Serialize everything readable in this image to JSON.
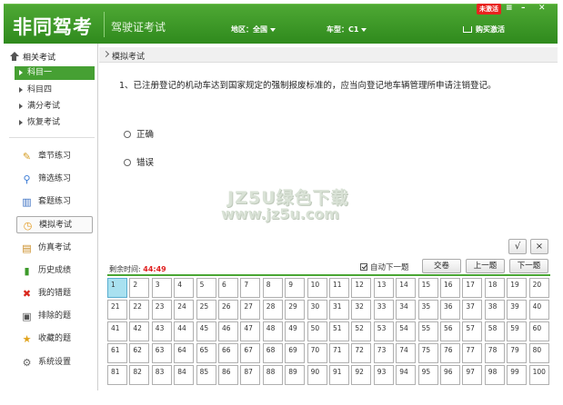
{
  "header": {
    "logo": "非同驾考",
    "subtitle": "驾驶证考试",
    "region": "地区：全国",
    "car_type": "车型：C1",
    "buy": "购买激活",
    "badge": "未激活",
    "menu_btn": "≡",
    "minimize_btn": "–",
    "close_btn": "✕"
  },
  "sidebar": {
    "heading": "相关考试",
    "subitems": [
      "科目一",
      "科目四",
      "满分考试",
      "恢复考试"
    ],
    "menu": [
      {
        "label": "章节练习",
        "icon": "pencil-icon"
      },
      {
        "label": "筛选练习",
        "icon": "search-icon"
      },
      {
        "label": "套题练习",
        "icon": "books-icon"
      },
      {
        "label": "模拟考试",
        "icon": "clock-icon"
      },
      {
        "label": "仿真考试",
        "icon": "monitor-icon"
      },
      {
        "label": "历史成绩",
        "icon": "bar-chart-icon"
      },
      {
        "label": "我的错题",
        "icon": "red-x-icon"
      },
      {
        "label": "排除的题",
        "icon": "clipboard-icon"
      },
      {
        "label": "收藏的题",
        "icon": "star-icon"
      },
      {
        "label": "系统设置",
        "icon": "gear-icon"
      }
    ]
  },
  "breadcrumb": "模拟考试",
  "question": {
    "text": "1、已注册登记的机动车达到国家规定的强制报废标准的，应当向登记地车辆管理所申请注销登记。",
    "options": [
      "正确",
      "错误"
    ]
  },
  "watermark": {
    "line1": "JZ5U绿色下载",
    "line2": "www.jz5u.com"
  },
  "answer_buttons": {
    "correct": "√",
    "wrong": "×"
  },
  "footer": {
    "time_label": "剩余时间:",
    "time_value": "44:49",
    "auto_next": "自动下一题",
    "submit": "交卷",
    "prev": "上一题",
    "next": "下一题"
  },
  "grid": {
    "total": 100,
    "current": 1
  },
  "colors": {
    "brand_green": "#46a033",
    "timer_red": "#e02020",
    "current_cell": "#a9e1f0"
  }
}
